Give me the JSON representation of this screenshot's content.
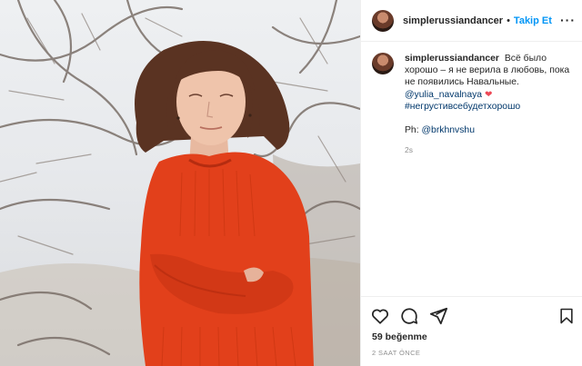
{
  "post": {
    "username": "simplerussiandancer",
    "separator": "•",
    "follow_label": "Takip Et",
    "more_icon": "more-horizontal-icon",
    "caption": {
      "username": "simplerussiandancer",
      "text": "Всё было хорошо – я не верила в любовь, пока не появились Навальные.",
      "mention": "@yulia_navalnaya",
      "heart": "❤",
      "hashtag": "#негрустивсебудетхорошо",
      "credit_prefix": "Ph:",
      "credit_handle": "@brkhnvshu",
      "age": "2s"
    },
    "actions": {
      "like_icon": "heart-outline-icon",
      "comment_icon": "comment-icon",
      "share_icon": "share-icon",
      "save_icon": "bookmark-icon"
    },
    "likes": "59 beğenme",
    "timestamp": "2 SAAT ÖNCE"
  },
  "colors": {
    "accent": "#0095f6",
    "link": "#00376b",
    "sweater": "#e2401b",
    "hair": "#5a3322",
    "heart": "#ed4956"
  }
}
